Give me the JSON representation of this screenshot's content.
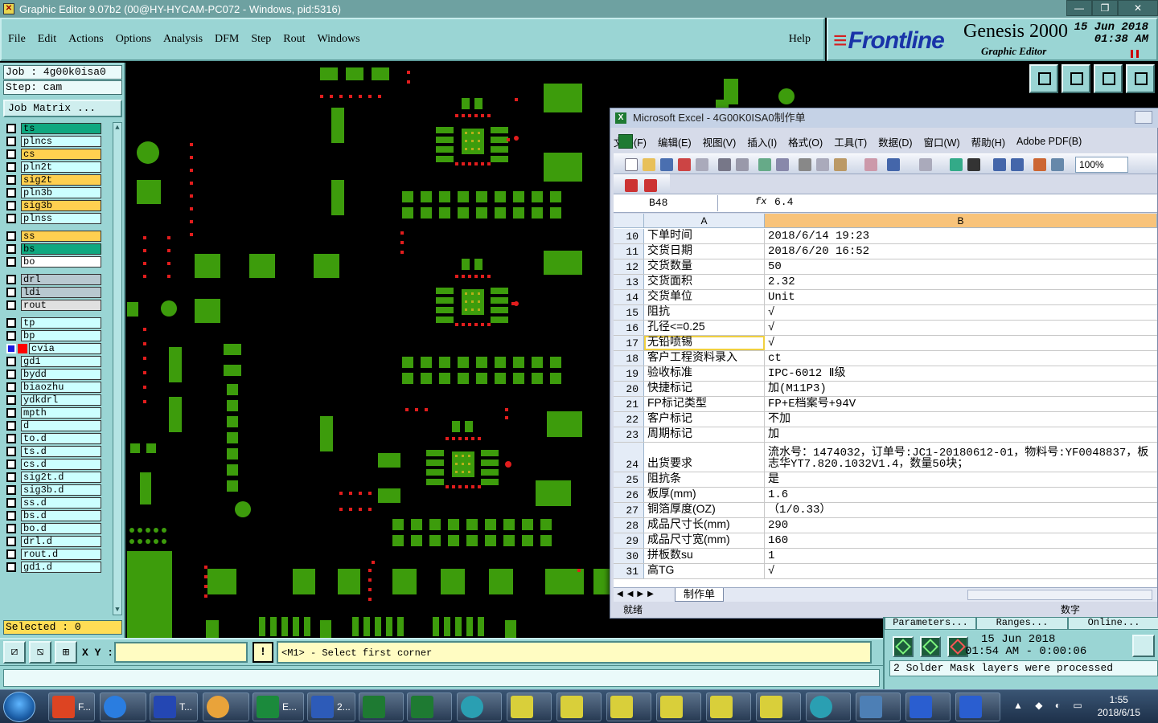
{
  "window": {
    "title": "Graphic Editor 9.07b2 (00@HY-HYCAM-PC072 - Windows, pid:5316)",
    "minimize": "—",
    "maximize": "❐",
    "close": "✕"
  },
  "menu": {
    "items": [
      "File",
      "Edit",
      "Actions",
      "Options",
      "Analysis",
      "DFM",
      "Step",
      "Rout",
      "Windows"
    ],
    "help": "Help"
  },
  "brand": {
    "logo": "Frontline",
    "product": "Genesis 2000",
    "subtitle": "Graphic Editor",
    "date": "15 Jun 2018",
    "time": "01:38 AM"
  },
  "job": {
    "job_line": "Job : 4g00k0isa0",
    "step_line": "Step: cam",
    "matrix_button": "Job Matrix ...",
    "selected": "Selected : 0"
  },
  "layers": [
    {
      "name": "ts",
      "color": "#10a880",
      "checked": false
    },
    {
      "name": "plncs",
      "color": "#ccffff",
      "checked": false
    },
    {
      "name": "cs",
      "color": "#ffd050",
      "checked": false
    },
    {
      "name": "pln2t",
      "color": "#ccffff",
      "checked": false
    },
    {
      "name": "sig2t",
      "color": "#ffd050",
      "checked": false
    },
    {
      "name": "pln3b",
      "color": "#ccffff",
      "checked": false
    },
    {
      "name": "sig3b",
      "color": "#ffd050",
      "checked": false
    },
    {
      "name": "plnss",
      "color": "#ccffff",
      "checked": false
    },
    {
      "name": "ss",
      "color": "#ffd050",
      "checked": false
    },
    {
      "name": "bs",
      "color": "#10a880",
      "checked": false
    },
    {
      "name": "bo",
      "color": "#ffffff",
      "checked": false
    },
    {
      "name": "drl",
      "color": "#b8c8d0",
      "checked": false
    },
    {
      "name": "ldi",
      "color": "#b8c8d0",
      "checked": false
    },
    {
      "name": "rout",
      "color": "#e0e0e0",
      "checked": false
    },
    {
      "name": "tp",
      "color": "#ccffff",
      "checked": false
    },
    {
      "name": "bp",
      "color": "#ccffff",
      "checked": false
    },
    {
      "name": "cvia",
      "color": "#ccffff",
      "checked": true
    },
    {
      "name": "gd1",
      "color": "#ccffff",
      "checked": false
    },
    {
      "name": "bydd",
      "color": "#ccffff",
      "checked": false
    },
    {
      "name": "biaozhu",
      "color": "#ccffff",
      "checked": false
    },
    {
      "name": "ydkdrl",
      "color": "#ccffff",
      "checked": false
    },
    {
      "name": "mpth",
      "color": "#ccffff",
      "checked": false
    },
    {
      "name": "d",
      "color": "#ccffff",
      "checked": false
    },
    {
      "name": "to.d",
      "color": "#ccffff",
      "checked": false
    },
    {
      "name": "ts.d",
      "color": "#ccffff",
      "checked": false
    },
    {
      "name": "cs.d",
      "color": "#ccffff",
      "checked": false
    },
    {
      "name": "sig2t.d",
      "color": "#ccffff",
      "checked": false
    },
    {
      "name": "sig3b.d",
      "color": "#ccffff",
      "checked": false
    },
    {
      "name": "ss.d",
      "color": "#ccffff",
      "checked": false
    },
    {
      "name": "bs.d",
      "color": "#ccffff",
      "checked": false
    },
    {
      "name": "bo.d",
      "color": "#ccffff",
      "checked": false
    },
    {
      "name": "drl.d",
      "color": "#ccffff",
      "checked": false
    },
    {
      "name": "rout.d",
      "color": "#ccffff",
      "checked": false
    },
    {
      "name": "gd1.d",
      "color": "#ccffff",
      "checked": false
    }
  ],
  "status": {
    "xy_label": "X Y :",
    "xy_value": "",
    "message": "<M1> - Select first corner"
  },
  "genesis_status": {
    "tabs": [
      "Parameters...",
      "Ranges...",
      "Online..."
    ],
    "date": "15 Jun 2018",
    "time_line": "01:54 AM - 0:00:06",
    "job_message": "2 Solder Mask layers were processed"
  },
  "excel": {
    "title": "Microsoft Excel - 4G00K0ISA0制作单",
    "menu": [
      "文件(F)",
      "编辑(E)",
      "视图(V)",
      "插入(I)",
      "格式(O)",
      "工具(T)",
      "数据(D)",
      "窗口(W)",
      "帮助(H)",
      "Adobe PDF(B)"
    ],
    "zoom": "100%",
    "name_box": "B48",
    "fx": "fx",
    "formula": "6.4",
    "columns": [
      "A",
      "B"
    ],
    "rows": [
      {
        "n": "10",
        "a": "下单时间",
        "b": "2018/6/14 19:23"
      },
      {
        "n": "11",
        "a": "交货日期",
        "b": "2018/6/20 16:52"
      },
      {
        "n": "12",
        "a": "交货数量",
        "b": "50"
      },
      {
        "n": "13",
        "a": "交货面积",
        "b": "2.32"
      },
      {
        "n": "14",
        "a": "交货单位",
        "b": "Unit"
      },
      {
        "n": "15",
        "a": "阻抗",
        "b": "√"
      },
      {
        "n": "16",
        "a": "孔径<=0.25",
        "b": "√"
      },
      {
        "n": "17",
        "a": "无铅喷锡",
        "b": "√"
      },
      {
        "n": "18",
        "a": "客户工程资料录入",
        "b": "ct"
      },
      {
        "n": "19",
        "a": "验收标准",
        "b": "IPC-6012 Ⅱ级"
      },
      {
        "n": "20",
        "a": "快捷标记",
        "b": "加(M11P3)"
      },
      {
        "n": "21",
        "a": "FP标记类型",
        "b": "FP+E档案号+94V"
      },
      {
        "n": "22",
        "a": "客户标记",
        "b": "不加"
      },
      {
        "n": "23",
        "a": "周期标记",
        "b": "加"
      },
      {
        "n": "24",
        "a": "出货要求",
        "b": "流水号：1474032，订单号:JC1-20180612-01，物料号:YF0048837，板",
        "b2": "志华YT7.820.1032V1.4，数量50块；"
      },
      {
        "n": "25",
        "a": "阻抗条",
        "b": "是"
      },
      {
        "n": "26",
        "a": "板厚(mm)",
        "b": "1.6"
      },
      {
        "n": "27",
        "a": "铜箔厚度(OZ)",
        "b": "（1/0.33）"
      },
      {
        "n": "28",
        "a": "成品尺寸长(mm)",
        "b": "290"
      },
      {
        "n": "29",
        "a": "成品尺寸宽(mm)",
        "b": "160"
      },
      {
        "n": "30",
        "a": "拼板数su",
        "b": "1"
      },
      {
        "n": "31",
        "a": "高TG",
        "b": "√"
      }
    ],
    "sheet_tab": "制作单",
    "status_ready": "就绪",
    "status_num": "数字"
  },
  "taskbar": {
    "items": [
      "F...",
      "T...",
      "E...",
      "2..."
    ],
    "clock_time": "1:55",
    "clock_date": "2018/6/15"
  },
  "colors": {
    "pcb_green": "#3d9c0c",
    "pad_red": "#e21d1d",
    "pad_yellow": "#b6b01a",
    "panel_cyan": "#9ad5d4"
  }
}
